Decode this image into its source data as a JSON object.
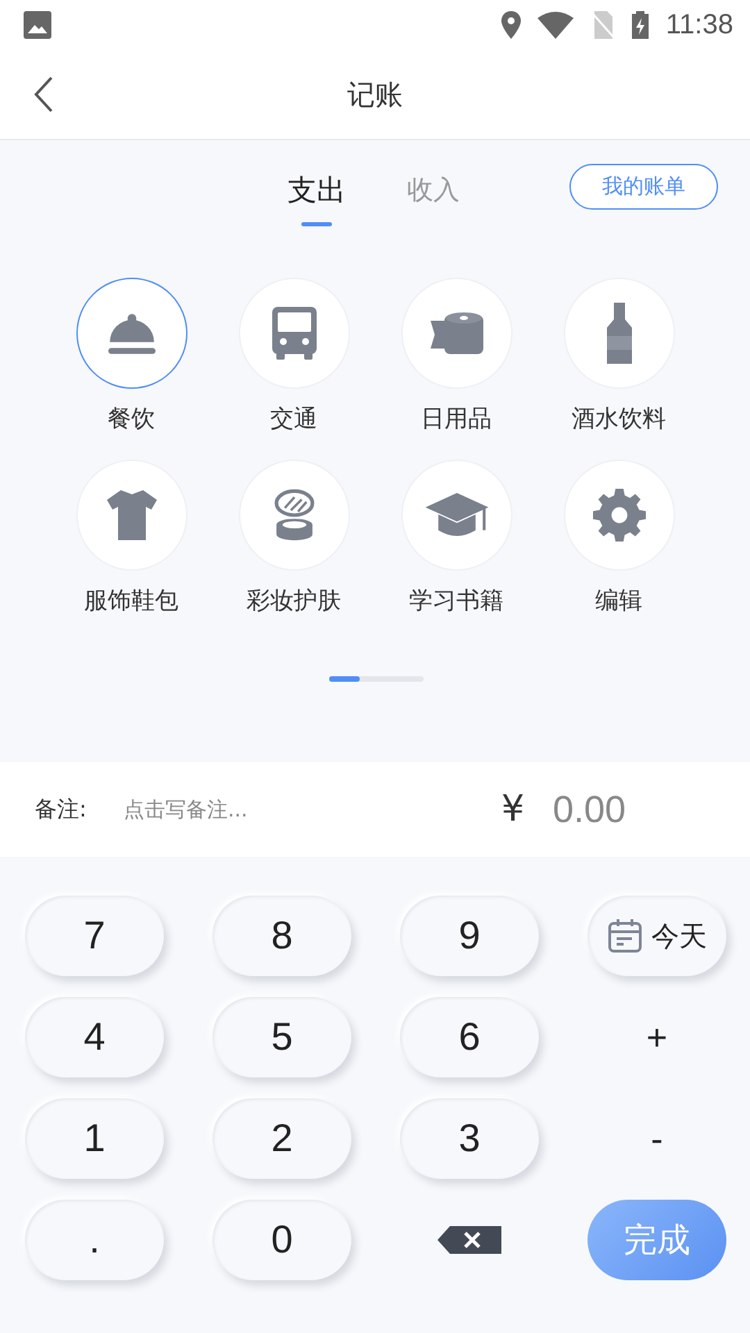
{
  "status_bar": {
    "time": "11:38"
  },
  "header": {
    "title": "记账"
  },
  "tabs": [
    {
      "label": "支出",
      "selected": true
    },
    {
      "label": "收入",
      "selected": false
    }
  ],
  "bill_button": "我的账单",
  "categories": [
    {
      "label": "餐饮",
      "selected": true
    },
    {
      "label": "交通",
      "selected": false
    },
    {
      "label": "日用品",
      "selected": false
    },
    {
      "label": "酒水饮料",
      "selected": false
    },
    {
      "label": "服饰鞋包",
      "selected": false
    },
    {
      "label": "彩妆护肤",
      "selected": false
    },
    {
      "label": "学习书籍",
      "selected": false
    },
    {
      "label": "编辑",
      "selected": false
    }
  ],
  "pager": {
    "level": 0.33
  },
  "note": {
    "label": "备注:",
    "placeholder": "点击写备注..."
  },
  "amount": {
    "currency": "¥",
    "value": "0.00"
  },
  "keys": [
    {
      "kind": "digit",
      "label": "7"
    },
    {
      "kind": "digit",
      "label": "8"
    },
    {
      "kind": "digit",
      "label": "9"
    },
    {
      "kind": "date",
      "label": "今天"
    },
    {
      "kind": "digit",
      "label": "4"
    },
    {
      "kind": "digit",
      "label": "5"
    },
    {
      "kind": "digit",
      "label": "6"
    },
    {
      "kind": "op",
      "label": "+"
    },
    {
      "kind": "digit",
      "label": "1"
    },
    {
      "kind": "digit",
      "label": "2"
    },
    {
      "kind": "digit",
      "label": "3"
    },
    {
      "kind": "op",
      "label": "-"
    },
    {
      "kind": "digit",
      "label": "."
    },
    {
      "kind": "digit",
      "label": "0"
    },
    {
      "kind": "backspace"
    },
    {
      "kind": "done",
      "label": "完成"
    }
  ]
}
